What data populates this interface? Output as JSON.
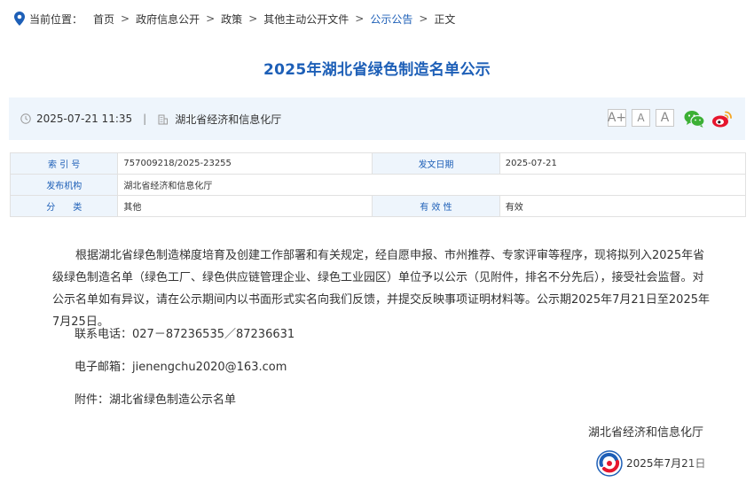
{
  "breadcrumb": {
    "prefix": "当前位置：",
    "items": [
      "首页",
      "政府信息公开",
      "政策",
      "其他主动公开文件",
      "公示公告",
      "正文"
    ],
    "separator": ">"
  },
  "article": {
    "title": "2025年湖北省绿色制造名单公示",
    "datetime": "2025-07-21 11:35",
    "source": "湖北省经济和信息化厅",
    "font_controls": [
      "A+",
      "A",
      "A"
    ],
    "share": [
      "wechat-icon",
      "weibo-icon"
    ]
  },
  "meta": {
    "index_label": "索 引 号",
    "index_value": "757009218/2025-23255",
    "date_label": "发文日期",
    "date_value": "2025-07-21",
    "org_label": "发布机构",
    "org_value": "湖北省经济和信息化厅",
    "category_label": "分　　类",
    "category_value": "其他",
    "validity_label": "有 效 性",
    "validity_value": "有效"
  },
  "body": {
    "paragraph": "根据湖北省绿色制造梯度培育及创建工作部署和有关规定，经自愿申报、市州推荐、专家评审等程序，现将拟列入2025年省级绿色制造名单（绿色工厂、绿色供应链管理企业、绿色工业园区）单位予以公示（见附件，排名不分先后），接受社会监督。对公示名单如有异议，请在公示期间内以书面形式实名向我们反馈，并提交反映事项证明材料等。公示期2025年7月21日至2025年7月25日。",
    "phone": "联系电话：027－87236535／87236631",
    "email": "电子邮箱：jienengchu2020@163.com",
    "attachment": "附件：湖北省绿色制造公示名单",
    "signature": "湖北省经济和信息化厅",
    "sign_date": "2025年7月21日"
  },
  "colors": {
    "accent": "#1d5fb7",
    "infobar_bg": "#eef5fc",
    "wechat": "#3cb035",
    "weibo": "#e6162d",
    "weibo_ring": "#f5a623"
  }
}
